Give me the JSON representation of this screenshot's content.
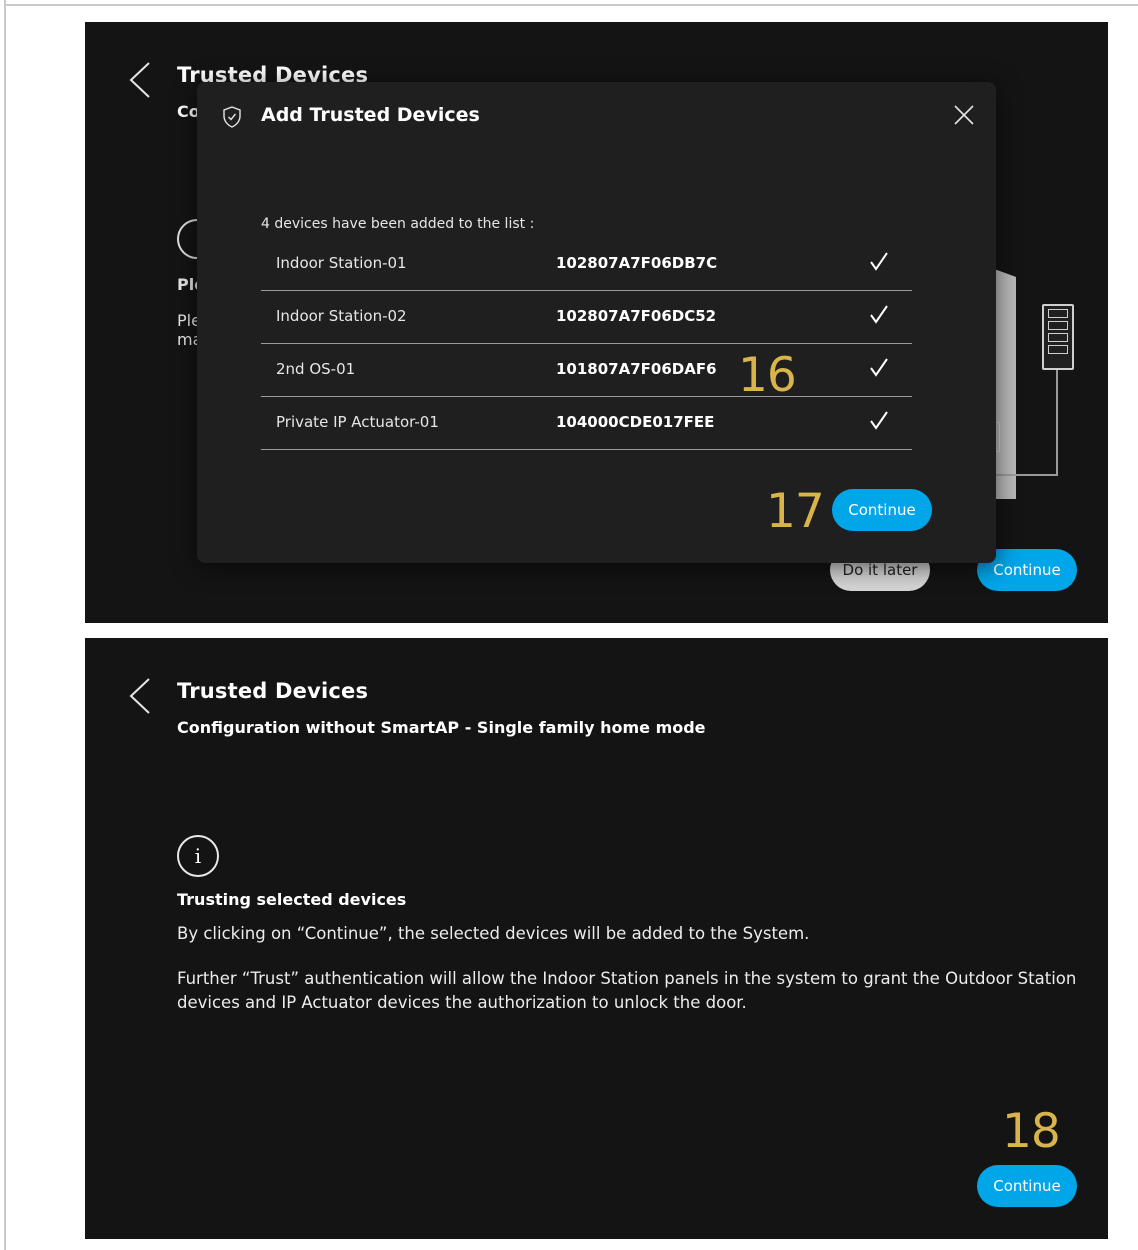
{
  "screen1": {
    "title": "Trusted Devices",
    "subtitle_partial": "Co",
    "bg_heading_partial": "Ple",
    "bg_text_partial_1": "Ple",
    "bg_text_partial_2": "ma",
    "do_it_later_label": "Do it later",
    "continue_label": "Continue",
    "modal": {
      "title": "Add Trusted Devices",
      "message": "4 devices have been added to the list :",
      "devices": [
        {
          "name": "Indoor Station-01",
          "id": "102807A7F06DB7C",
          "checked": true
        },
        {
          "name": "Indoor Station-02",
          "id": "102807A7F06DC52",
          "checked": true
        },
        {
          "name": "2nd OS-01",
          "id": "101807A7F06DAF6",
          "checked": true
        },
        {
          "name": "Private IP Actuator-01",
          "id": "104000CDE017FEE",
          "checked": true
        }
      ],
      "continue_label": "Continue"
    },
    "markers": {
      "m16": "16",
      "m17": "17"
    }
  },
  "screen2": {
    "title": "Trusted Devices",
    "subtitle": "Configuration without SmartAP - Single family home mode",
    "info_icon": "i",
    "heading": "Trusting selected devices",
    "paragraph1": "By clicking on “Continue”, the selected devices will be added to the System.",
    "paragraph2": "Further “Trust” authentication will allow the Indoor Station panels in the system to grant the Outdoor Station devices and IP Actuator devices the authorization to unlock the door.",
    "continue_label": "Continue",
    "marker": "18"
  },
  "icons": {
    "back": "chevron-left-icon",
    "shield": "shield-check-icon",
    "close": "close-icon",
    "check": "checkmark-icon",
    "info": "info-icon"
  },
  "colors": {
    "background": "#141414",
    "modal": "#1f1f1f",
    "accent_blue": "#00a6e8",
    "marker_gold": "#d9b44a"
  }
}
